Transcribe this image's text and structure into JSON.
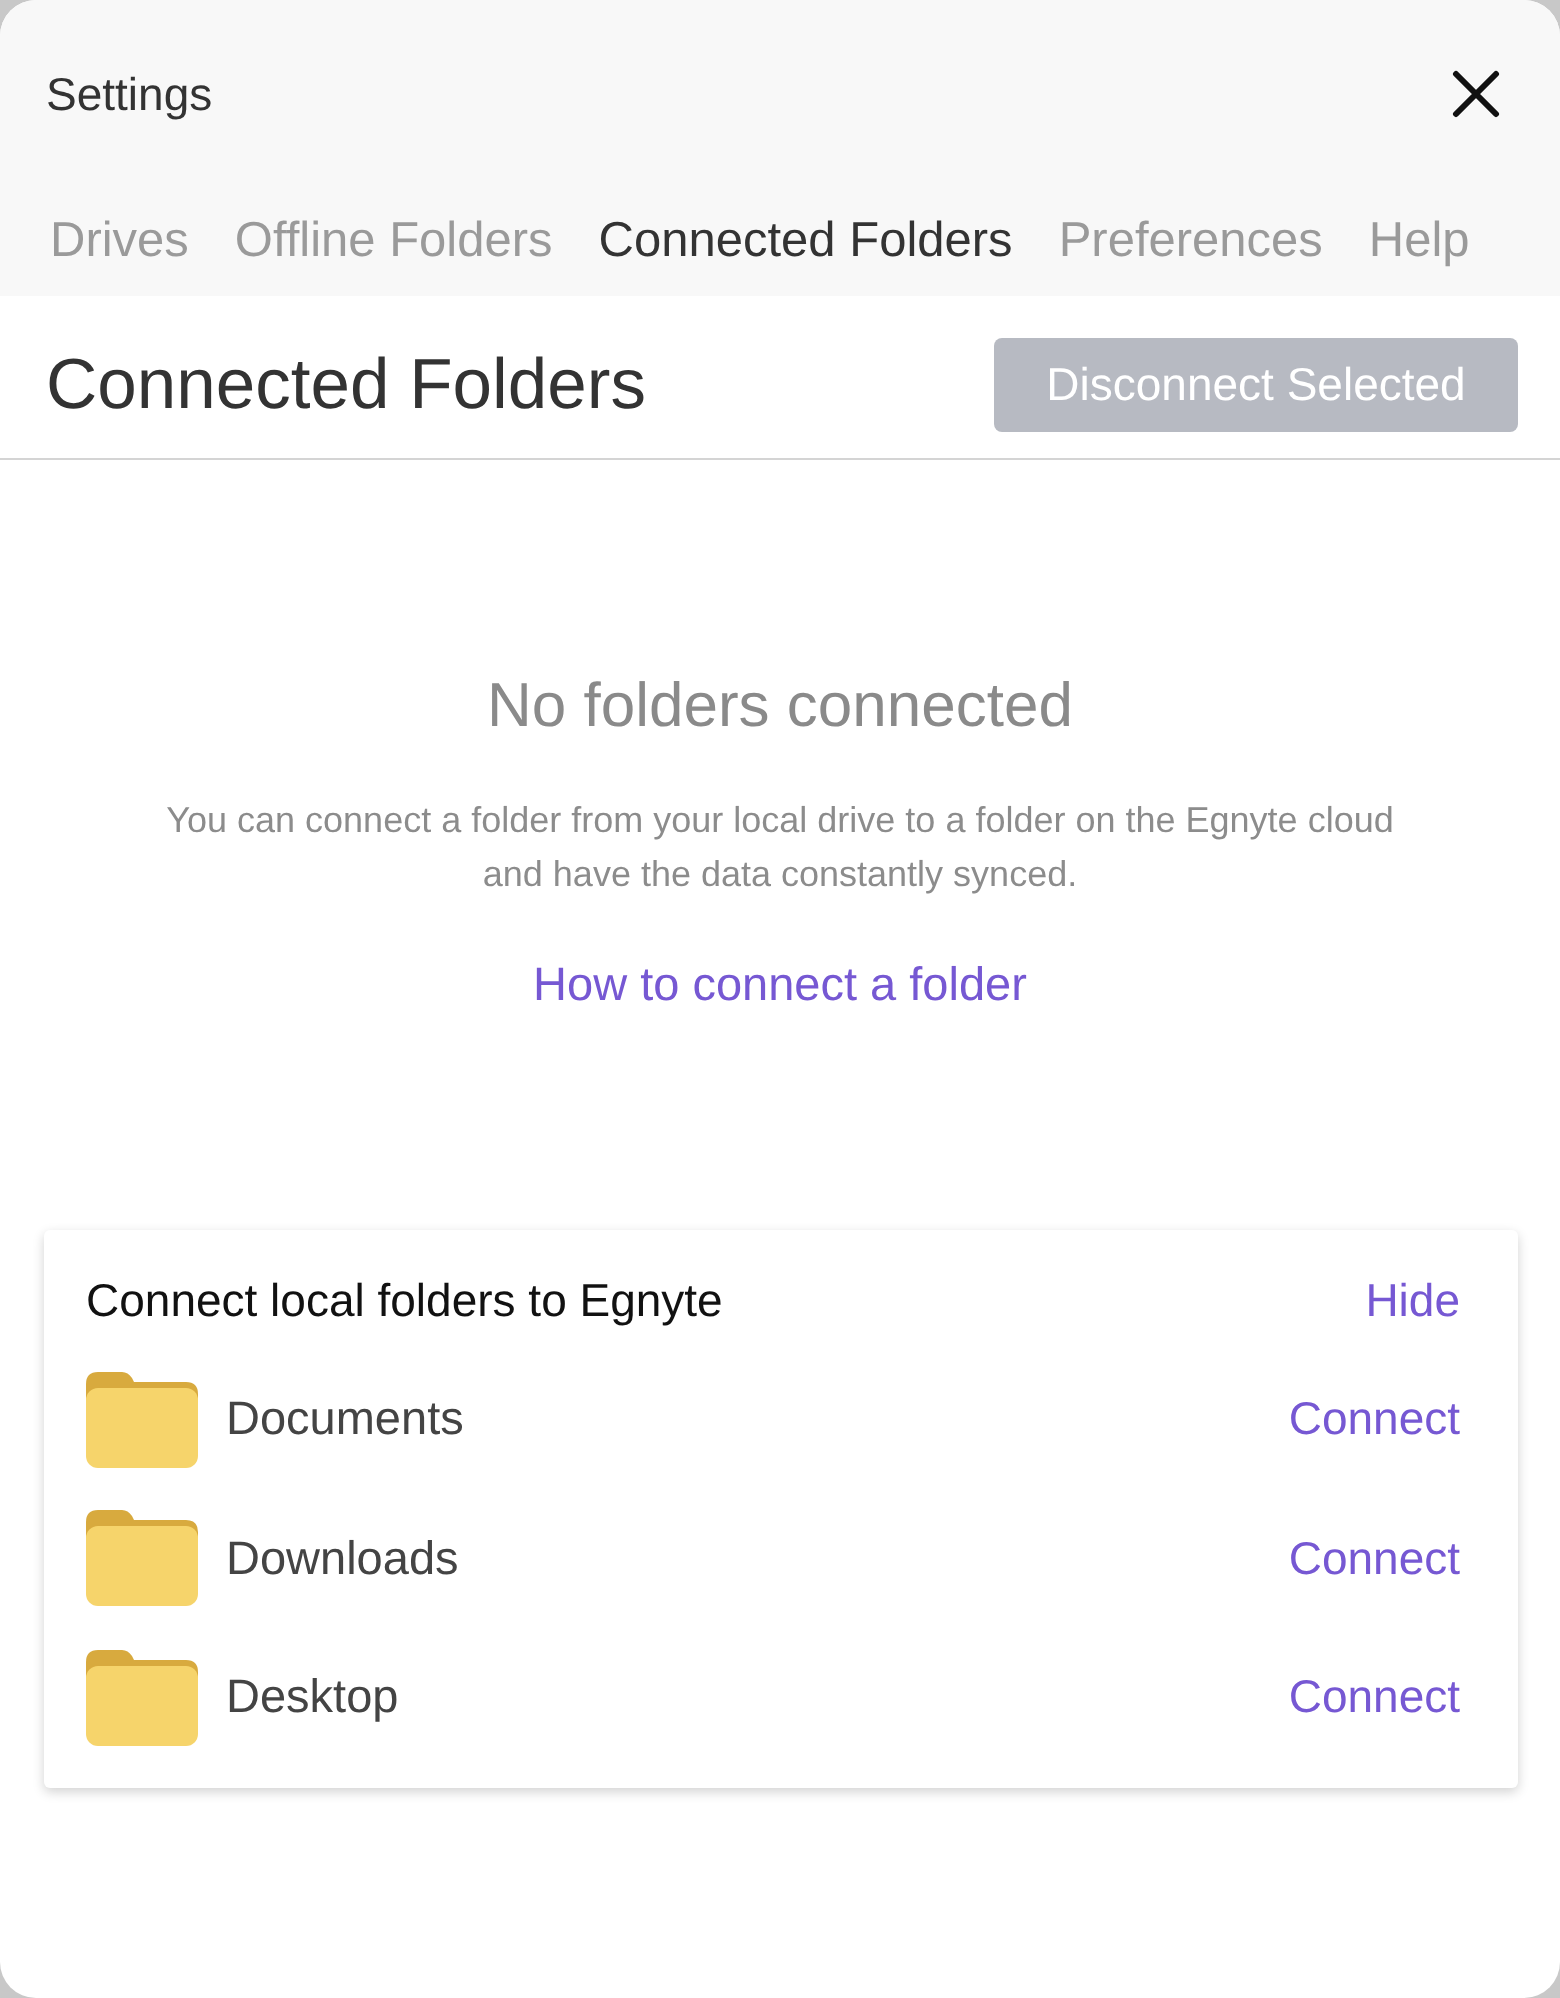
{
  "window": {
    "title": "Settings"
  },
  "tabs": [
    {
      "label": "Drives",
      "selected": false
    },
    {
      "label": "Offline Folders",
      "selected": false
    },
    {
      "label": "Connected Folders",
      "selected": true
    },
    {
      "label": "Preferences",
      "selected": false
    },
    {
      "label": "Help",
      "selected": false
    }
  ],
  "page": {
    "heading": "Connected Folders",
    "disconnect_button": {
      "label": "Disconnect Selected",
      "disabled": true
    }
  },
  "empty_state": {
    "title": "No folders connected",
    "description": "You can connect a folder from your local drive to a folder on the Egnyte cloud and have the data constantly synced.",
    "link": "How to connect a folder"
  },
  "suggestions": {
    "title": "Connect local folders to Egnyte",
    "hide_link": "Hide",
    "folders": [
      {
        "name": "Documents",
        "action": "Connect"
      },
      {
        "name": "Downloads",
        "action": "Connect"
      },
      {
        "name": "Desktop",
        "action": "Connect"
      }
    ]
  }
}
